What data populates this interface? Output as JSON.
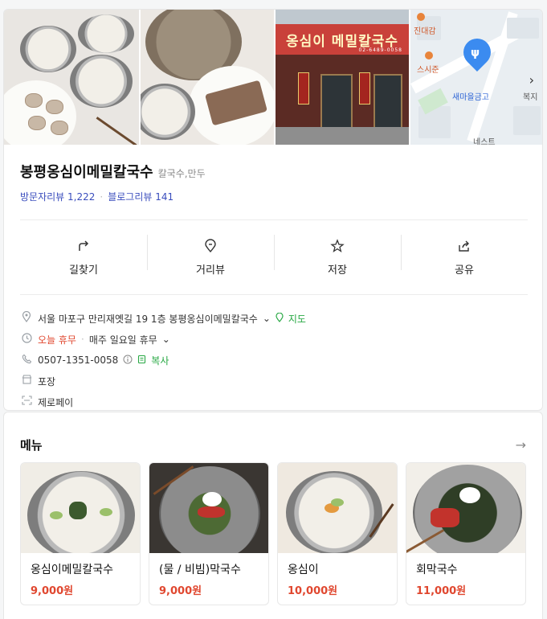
{
  "photos": {
    "store_sign": "옹심이 메밀칼국수",
    "store_phone_small": "02-6489-0058"
  },
  "map": {
    "labels": {
      "top": "진대감",
      "mid": "스시준",
      "bank": "새마을금고",
      "right": "복지",
      "bottom": "네스트"
    }
  },
  "place": {
    "name": "봉평옹심이메밀칼국수",
    "category": "칼국수,만두",
    "visitor_review": "방문자리뷰 1,222",
    "blog_review": "블로그리뷰 141"
  },
  "actions": [
    {
      "label": "길찾기",
      "icon": "directions-icon"
    },
    {
      "label": "거리뷰",
      "icon": "street-view-icon"
    },
    {
      "label": "저장",
      "icon": "star-icon"
    },
    {
      "label": "공유",
      "icon": "share-icon"
    }
  ],
  "details": {
    "address": "서울 마포구 만리재옛길 19 1층 봉평옹심이메밀칼국수",
    "map_link": "지도",
    "today_status": "오늘 휴무",
    "hours_note": "매주 일요일 휴무",
    "phone": "0507-1351-0058",
    "copy_label": "복사",
    "takeout": "포장",
    "payment": "제로페이"
  },
  "menu": {
    "title": "메뉴",
    "items": [
      {
        "name": "옹심이메밀칼국수",
        "price": "9,000원"
      },
      {
        "name": "(물 / 비빔)막국수",
        "price": "9,000원"
      },
      {
        "name": "옹심이",
        "price": "10,000원"
      },
      {
        "name": "회막국수",
        "price": "11,000원"
      }
    ]
  },
  "colors": {
    "accent_blue": "#3a4dbd",
    "accent_green": "#27a843",
    "accent_red": "#e0472f"
  }
}
